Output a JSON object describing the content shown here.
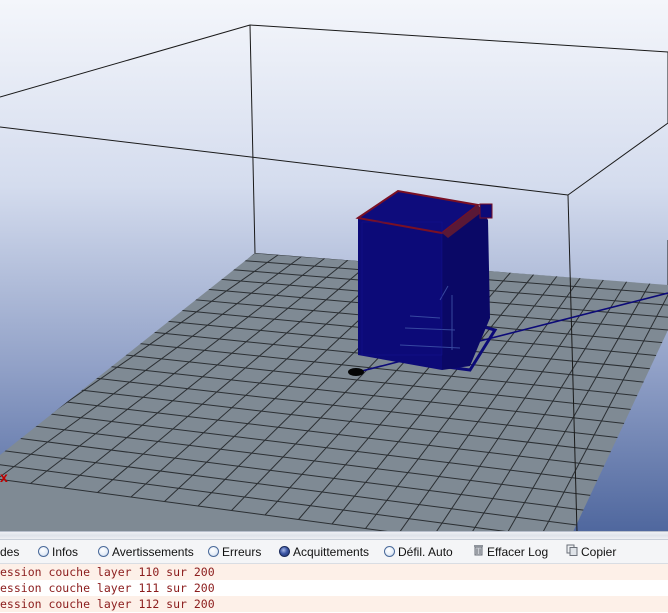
{
  "viewport": {
    "axis_label": "x",
    "colors": {
      "sky_top": "#f2f5fb",
      "sky_bottom": "#5b72a4",
      "bed": "#7f8a94",
      "grid_line": "#2b2f33",
      "object": "#0c0a78",
      "object_top_edge": "#7a1024",
      "axis_label": "#c00000"
    }
  },
  "toolbar": {
    "items": [
      {
        "label": "des",
        "type": "tab"
      },
      {
        "label": "Infos",
        "type": "radio",
        "checked": false
      },
      {
        "label": "Avertissements",
        "type": "radio",
        "checked": false
      },
      {
        "label": "Erreurs",
        "type": "radio",
        "checked": false
      },
      {
        "label": "Acquittements",
        "type": "radio",
        "checked": true
      },
      {
        "label": "Défil. Auto",
        "type": "radio",
        "checked": false
      },
      {
        "label": "Effacer Log",
        "type": "button",
        "icon": "trash-icon"
      },
      {
        "label": "Copier",
        "type": "button",
        "icon": "copy-icon"
      }
    ]
  },
  "log": {
    "lines": [
      "ession couche layer 110 sur 200",
      "ession couche layer 111 sur 200",
      "ession couche layer 112 sur 200"
    ]
  }
}
